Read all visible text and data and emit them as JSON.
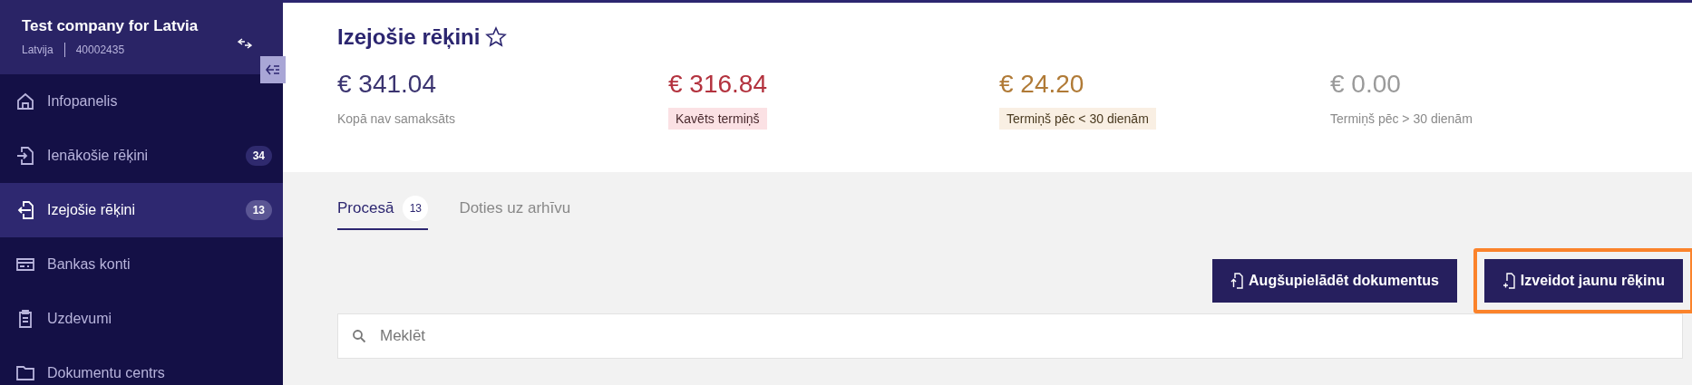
{
  "company": {
    "name": "Test company for Latvia",
    "country": "Latvija",
    "reg_number": "40002435"
  },
  "sidebar": {
    "items": [
      {
        "label": "Infopanelis",
        "selected": false
      },
      {
        "label": "Ienākošie rēķini",
        "badge": "34",
        "selected": false
      },
      {
        "label": "Izejošie rēķini",
        "badge": "13",
        "selected": true
      },
      {
        "label": "Bankas konti",
        "selected": false
      },
      {
        "label": "Uzdevumi",
        "selected": false
      },
      {
        "label": "Dokumentu centrs",
        "selected": false
      }
    ]
  },
  "page": {
    "title": "Izejošie rēķini",
    "favorite": false
  },
  "stats": [
    {
      "amount": "€ 341.04",
      "label": "Kopā nav samaksāts"
    },
    {
      "amount": "€ 316.84",
      "label": "Kavēts termiņš"
    },
    {
      "amount": "€ 24.20",
      "label": "Termiņš pēc < 30 dienām"
    },
    {
      "amount": "€ 0.00",
      "label": "Termiņš pēc > 30 dienām"
    }
  ],
  "tabs": [
    {
      "label": "Procesā",
      "count": "13",
      "selected": true
    },
    {
      "label": "Doties uz arhīvu",
      "selected": false
    }
  ],
  "buttons": [
    {
      "label": "Augšupielādēt dokumentus",
      "highlighted": false
    },
    {
      "label": "Izveidot jaunu rēķinu",
      "highlighted": true
    }
  ],
  "search": {
    "placeholder": "Meklēt"
  }
}
